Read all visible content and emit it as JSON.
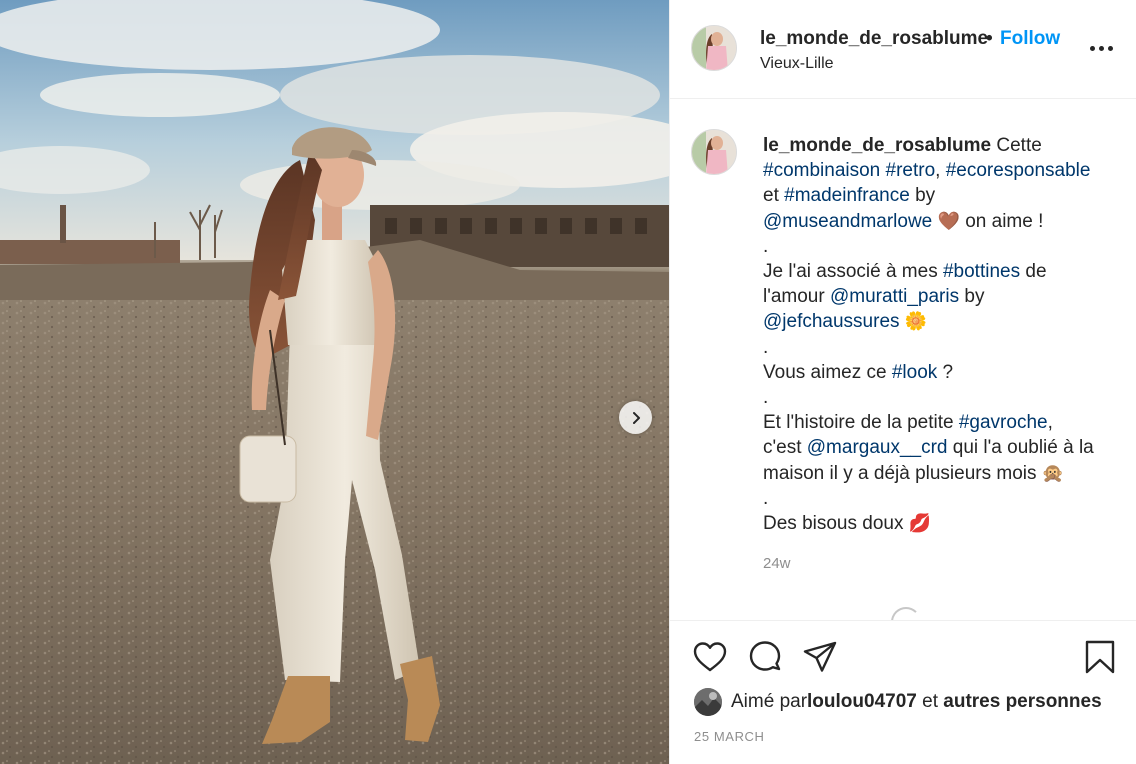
{
  "post": {
    "username": "le_monde_de_rosablume",
    "separator": "•",
    "follow_label": "Follow",
    "location": "Vieux-Lille",
    "more_icon": "more-horizontal-icon"
  },
  "photo": {
    "alt": "Woman in cream overalls, newsboy cap and tan boots standing on a gravel lot",
    "next_icon": "chevron-right-icon"
  },
  "caption": {
    "username": "le_monde_de_rosablume",
    "parts": [
      {
        "t": " Cette\n"
      },
      {
        "t": "#combinaison",
        "tag": true
      },
      {
        "t": " "
      },
      {
        "t": "#retro",
        "tag": true
      },
      {
        "t": ", "
      },
      {
        "t": "#ecoresponsable",
        "tag": true
      },
      {
        "t": "\net "
      },
      {
        "t": "#madeinfrance",
        "tag": true
      },
      {
        "t": " by\n"
      },
      {
        "t": "@museandmarlowe",
        "tag": true
      },
      {
        "t": " "
      },
      {
        "t": "🤎",
        "emoji": true
      },
      {
        "t": " on aime !\n.\nJe l'ai associé à mes "
      },
      {
        "t": "#bottines",
        "tag": true
      },
      {
        "t": " de\nl'amour "
      },
      {
        "t": "@muratti_paris",
        "tag": true
      },
      {
        "t": " by\n"
      },
      {
        "t": "@jefchaussures",
        "tag": true
      },
      {
        "t": " "
      },
      {
        "t": "🌼",
        "emoji": true
      },
      {
        "t": "\n.\nVous aimez ce "
      },
      {
        "t": "#look",
        "tag": true
      },
      {
        "t": " ?\n.\nEt l'histoire de la petite "
      },
      {
        "t": "#gavroche",
        "tag": true
      },
      {
        "t": ",\nc'est "
      },
      {
        "t": "@margaux__crd",
        "tag": true
      },
      {
        "t": " qui l'a oublié à la\nmaison il y a déjà plusieurs mois "
      },
      {
        "t": "🙊",
        "emoji": true
      },
      {
        "t": "\n.\nDes bisous doux "
      },
      {
        "t": "💋",
        "emoji": true
      }
    ],
    "age": "24w"
  },
  "actions": {
    "like_icon": "heart-icon",
    "comment_icon": "comment-icon",
    "share_icon": "send-icon",
    "save_icon": "bookmark-icon"
  },
  "likes": {
    "prefix": "Aimé par ",
    "user": "loulou04707",
    "middle": " et ",
    "suffix": "autres personnes"
  },
  "date": "25 MARCH",
  "colors": {
    "link_blue": "#0095f6",
    "tag_blue": "#00376b",
    "text": "#262626",
    "muted": "#8e8e8e",
    "border": "#efefef"
  }
}
